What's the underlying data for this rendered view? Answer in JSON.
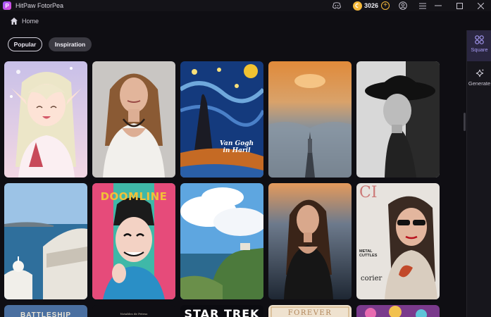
{
  "window": {
    "title": "HitPaw FotorPea",
    "coins": "3026"
  },
  "breadcrumb": {
    "home_label": "Home"
  },
  "filters": {
    "popular": "Popular",
    "inspiration": "Inspiration"
  },
  "sidebar": {
    "items": [
      {
        "label": "Square",
        "icon": "square-grid-icon",
        "active": true
      },
      {
        "label": "Generate",
        "icon": "sparkle-icon",
        "active": false
      }
    ]
  },
  "gallery": {
    "row1": [
      {
        "subject": "anime-elf-girl",
        "caption": ""
      },
      {
        "subject": "woman-white-dress",
        "caption": ""
      },
      {
        "subject": "starry-night-painting",
        "caption": "Van Gogh in Haril"
      },
      {
        "subject": "ship-at-sunset",
        "caption": ""
      },
      {
        "subject": "bw-woman-hat",
        "caption": ""
      }
    ],
    "row2": [
      {
        "subject": "santorini-coast",
        "caption": ""
      },
      {
        "subject": "comic-skeleton-man",
        "caption": "DOOMLINE"
      },
      {
        "subject": "coastal-cliffs-clouds",
        "caption": ""
      },
      {
        "subject": "woman-by-sea",
        "caption": ""
      },
      {
        "subject": "magazine-cover-woman",
        "caption": "METAL CUTTLES",
        "magazine_sub": "corier"
      }
    ],
    "row3": [
      {
        "subject": "battleship-poster",
        "caption": "BATTLESHIP"
      },
      {
        "subject": "dark-poster",
        "caption": "Notables de Peteso"
      },
      {
        "subject": "star-trek-poster",
        "caption": "STAR TREK"
      },
      {
        "subject": "forever-poster",
        "caption": "FOREVER"
      },
      {
        "subject": "colorful-sweets",
        "caption": ""
      }
    ]
  }
}
